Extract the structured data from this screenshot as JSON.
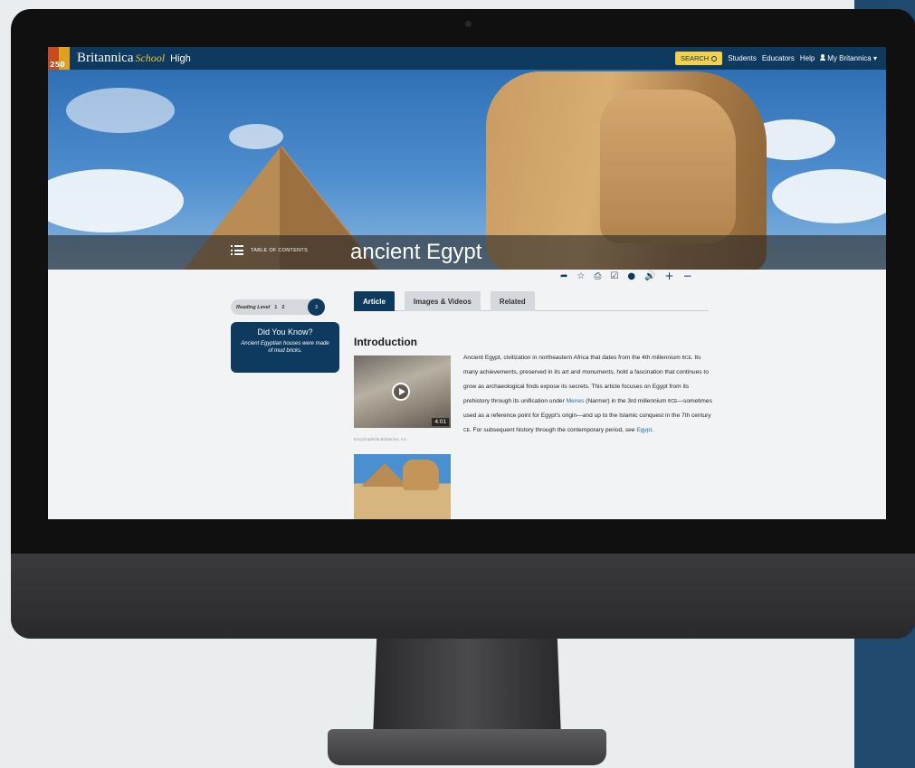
{
  "header": {
    "logo_number": "250",
    "brand": "Britannica",
    "brand_school": "School",
    "brand_level": "High",
    "search_label": "SEARCH",
    "nav": [
      "Students",
      "Educators",
      "Help"
    ],
    "account_label": "My Britannica ▾"
  },
  "hero": {
    "toc_label": "TABLE OF CONTENTS",
    "title": "ancient Egypt"
  },
  "tools": {
    "icons": [
      "share-icon",
      "star-icon",
      "print-icon",
      "checklist-icon",
      "globe-icon",
      "audio-icon",
      "zoom-in-icon",
      "zoom-out-icon"
    ],
    "glyphs": [
      "➦",
      "☆",
      "⎙",
      "☑",
      "●",
      "🔊",
      "+",
      "−"
    ]
  },
  "sidebar": {
    "reading_level_label": "Reading Level",
    "levels": [
      "1",
      "2",
      "3"
    ],
    "active_level": "3",
    "did_you_know_title": "Did You Know?",
    "did_you_know_text": "Ancient Egyptian houses were made of mud bricks."
  },
  "tabs": [
    "Article",
    "Images & Videos",
    "Related"
  ],
  "active_tab": "Article",
  "article": {
    "section_title": "Introduction",
    "video_duration": "4:01",
    "credit": "Encyclopædia Britannica, Inc.",
    "text_1": "Ancient Egypt, civilization in northeastern Africa that dates from the 4th millennium ",
    "bce_1": "BCE",
    "text_2": ". Its many achievements, preserved in its art and monuments, hold a fascination that continues to grow as archaeological finds expose its secrets. This article focuses on Egypt from its prehistory through its unification under ",
    "link_menes": "Menes",
    "text_3": " (Narmer) in the 3rd millennium ",
    "bce_2": "BCE",
    "text_4": "—sometimes used as a reference point for Egypt's origin—and up to the Islamic conquest in the 7th century ",
    "ce": "CE",
    "text_5": ". For subsequent history through the contemporary period, ",
    "see": "see",
    "link_egypt": "Egypt",
    "text_6": "."
  },
  "colors": {
    "brand_navy": "#0d3a5e",
    "search_yellow": "#f4d14b",
    "link_blue": "#1f6fb5",
    "side_panel": "#1f4a6d"
  }
}
